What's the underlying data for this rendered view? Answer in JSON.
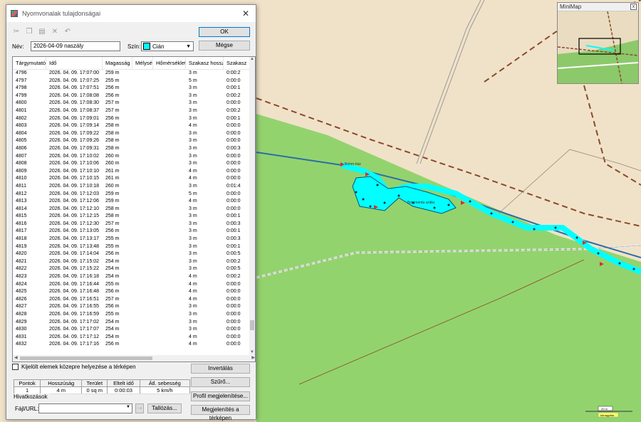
{
  "dialog": {
    "title": "Nyomvonalak tulajdonságai",
    "close_glyph": "✕",
    "ok_label": "OK",
    "cancel_label": "Mégse",
    "name_label": "Név:",
    "name_value": "2026-04-09 naszály",
    "color_label": "Szín:",
    "color_value": "Cián",
    "color_hex": "#00ffff",
    "toolbar_icons": [
      "cut-icon",
      "copy-icon",
      "paste-icon",
      "delete-icon",
      "undo-icon"
    ],
    "columns": [
      "Tárgymutató",
      "Idő",
      "Magasság",
      "Mélység",
      "Hőmérséklet",
      "Szakasz hossza",
      "Szakasz"
    ],
    "rows": [
      [
        "4796",
        "2026. 04. 09. 17:07:00",
        "259 m",
        "",
        "",
        "3 m",
        "0:00:2"
      ],
      [
        "4797",
        "2026. 04. 09. 17:07:25",
        "255 m",
        "",
        "",
        "5 m",
        "0:00:0"
      ],
      [
        "4798",
        "2026. 04. 09. 17:07:51",
        "256 m",
        "",
        "",
        "3 m",
        "0:00:1"
      ],
      [
        "4799",
        "2026. 04. 09. 17:08:08",
        "256 m",
        "",
        "",
        "3 m",
        "0:00:2"
      ],
      [
        "4800",
        "2026. 04. 09. 17:08:30",
        "257 m",
        "",
        "",
        "3 m",
        "0:00:0"
      ],
      [
        "4801",
        "2026. 04. 09. 17:08:37",
        "257 m",
        "",
        "",
        "3 m",
        "0:00:2"
      ],
      [
        "4802",
        "2026. 04. 09. 17:09:01",
        "256 m",
        "",
        "",
        "3 m",
        "0:00:1"
      ],
      [
        "4803",
        "2026. 04. 09. 17:09:14",
        "258 m",
        "",
        "",
        "4 m",
        "0:00:0"
      ],
      [
        "4804",
        "2026. 04. 09. 17:09:22",
        "258 m",
        "",
        "",
        "3 m",
        "0:00:0"
      ],
      [
        "4805",
        "2026. 04. 09. 17:09:26",
        "258 m",
        "",
        "",
        "3 m",
        "0:00:0"
      ],
      [
        "4806",
        "2026. 04. 09. 17:09:31",
        "258 m",
        "",
        "",
        "3 m",
        "0:00:3"
      ],
      [
        "4807",
        "2026. 04. 09. 17:10:02",
        "260 m",
        "",
        "",
        "3 m",
        "0:00:0"
      ],
      [
        "4808",
        "2026. 04. 09. 17:10:06",
        "260 m",
        "",
        "",
        "3 m",
        "0:00:0"
      ],
      [
        "4809",
        "2026. 04. 09. 17:10:10",
        "261 m",
        "",
        "",
        "4 m",
        "0:00:0"
      ],
      [
        "4810",
        "2026. 04. 09. 17:10:15",
        "261 m",
        "",
        "",
        "4 m",
        "0:00:0"
      ],
      [
        "4811",
        "2026. 04. 09. 17:10:18",
        "260 m",
        "",
        "",
        "3 m",
        "0:01:4"
      ],
      [
        "4812",
        "2026. 04. 09. 17:12:03",
        "259 m",
        "",
        "",
        "5 m",
        "0:00:0"
      ],
      [
        "4813",
        "2026. 04. 09. 17:12:06",
        "259 m",
        "",
        "",
        "4 m",
        "0:00:0"
      ],
      [
        "4814",
        "2026. 04. 09. 17:12:10",
        "258 m",
        "",
        "",
        "3 m",
        "0:00:0"
      ],
      [
        "4815",
        "2026. 04. 09. 17:12:15",
        "258 m",
        "",
        "",
        "3 m",
        "0:00:1"
      ],
      [
        "4816",
        "2026. 04. 09. 17:12:30",
        "257 m",
        "",
        "",
        "3 m",
        "0:00:3"
      ],
      [
        "4817",
        "2026. 04. 09. 17:13:05",
        "256 m",
        "",
        "",
        "3 m",
        "0:00:1"
      ],
      [
        "4818",
        "2026. 04. 09. 17:13:17",
        "255 m",
        "",
        "",
        "3 m",
        "0:00:3"
      ],
      [
        "4819",
        "2026. 04. 09. 17:13:48",
        "255 m",
        "",
        "",
        "3 m",
        "0:00:1"
      ],
      [
        "4820",
        "2026. 04. 09. 17:14:04",
        "256 m",
        "",
        "",
        "3 m",
        "0:00:5"
      ],
      [
        "4821",
        "2026. 04. 09. 17:15:02",
        "254 m",
        "",
        "",
        "3 m",
        "0:00:2"
      ],
      [
        "4822",
        "2026. 04. 09. 17:15:22",
        "254 m",
        "",
        "",
        "3 m",
        "0:00:5"
      ],
      [
        "4823",
        "2026. 04. 09. 17:16:18",
        "254 m",
        "",
        "",
        "4 m",
        "0:00:2"
      ],
      [
        "4824",
        "2026. 04. 09. 17:16:44",
        "255 m",
        "",
        "",
        "4 m",
        "0:00:0"
      ],
      [
        "4825",
        "2026. 04. 09. 17:16:48",
        "256 m",
        "",
        "",
        "4 m",
        "0:00:0"
      ],
      [
        "4826",
        "2026. 04. 09. 17:16:51",
        "257 m",
        "",
        "",
        "4 m",
        "0:00:0"
      ],
      [
        "4827",
        "2026. 04. 09. 17:16:55",
        "256 m",
        "",
        "",
        "3 m",
        "0:00:0"
      ],
      [
        "4828",
        "2026. 04. 09. 17:16:59",
        "255 m",
        "",
        "",
        "3 m",
        "0:00:0"
      ],
      [
        "4829",
        "2026. 04. 09. 17:17:02",
        "254 m",
        "",
        "",
        "3 m",
        "0:00:0"
      ],
      [
        "4830",
        "2026. 04. 09. 17:17:07",
        "254 m",
        "",
        "",
        "3 m",
        "0:00:0"
      ],
      [
        "4831",
        "2026. 04. 09. 17:17:12",
        "254 m",
        "",
        "",
        "4 m",
        "0:00:0"
      ],
      [
        "4832",
        "2026. 04. 09. 17:17:16",
        "256 m",
        "",
        "",
        "4 m",
        "0:00:0"
      ]
    ],
    "center_checkbox_label": "Kijelölt elemek közepre helyezése a térképen",
    "center_checkbox_checked": false,
    "stats_headers": [
      "Pontok",
      "Hosszúság",
      "Terület",
      "Eltelt idő",
      "Átl. sebesség"
    ],
    "stats_values": [
      "1",
      "4 m",
      "0 sq m",
      "0:00:03",
      "5 km/h"
    ],
    "links_title": "Hivatkozások",
    "file_url_label": "Fájl/URL:",
    "file_url_value": "",
    "browse_label": "Tallózás...",
    "invert_label": "Invertálás",
    "filter_label": "Szűrő...",
    "profile_label": "Profil megjelenítése...",
    "show_on_map_label": "Megjelenítés a térképen"
  },
  "minimap": {
    "title": "MiniMap",
    "close_glyph": "x"
  },
  "map": {
    "labels": [
      "Bohm-ház",
      "Borsmenta szikla"
    ],
    "scale_label": "20 m",
    "zoom_label": "túlnagyítás",
    "track_color": "#00ffff",
    "forest_color": "#93d36e",
    "land_color": "#f0e2c8"
  }
}
